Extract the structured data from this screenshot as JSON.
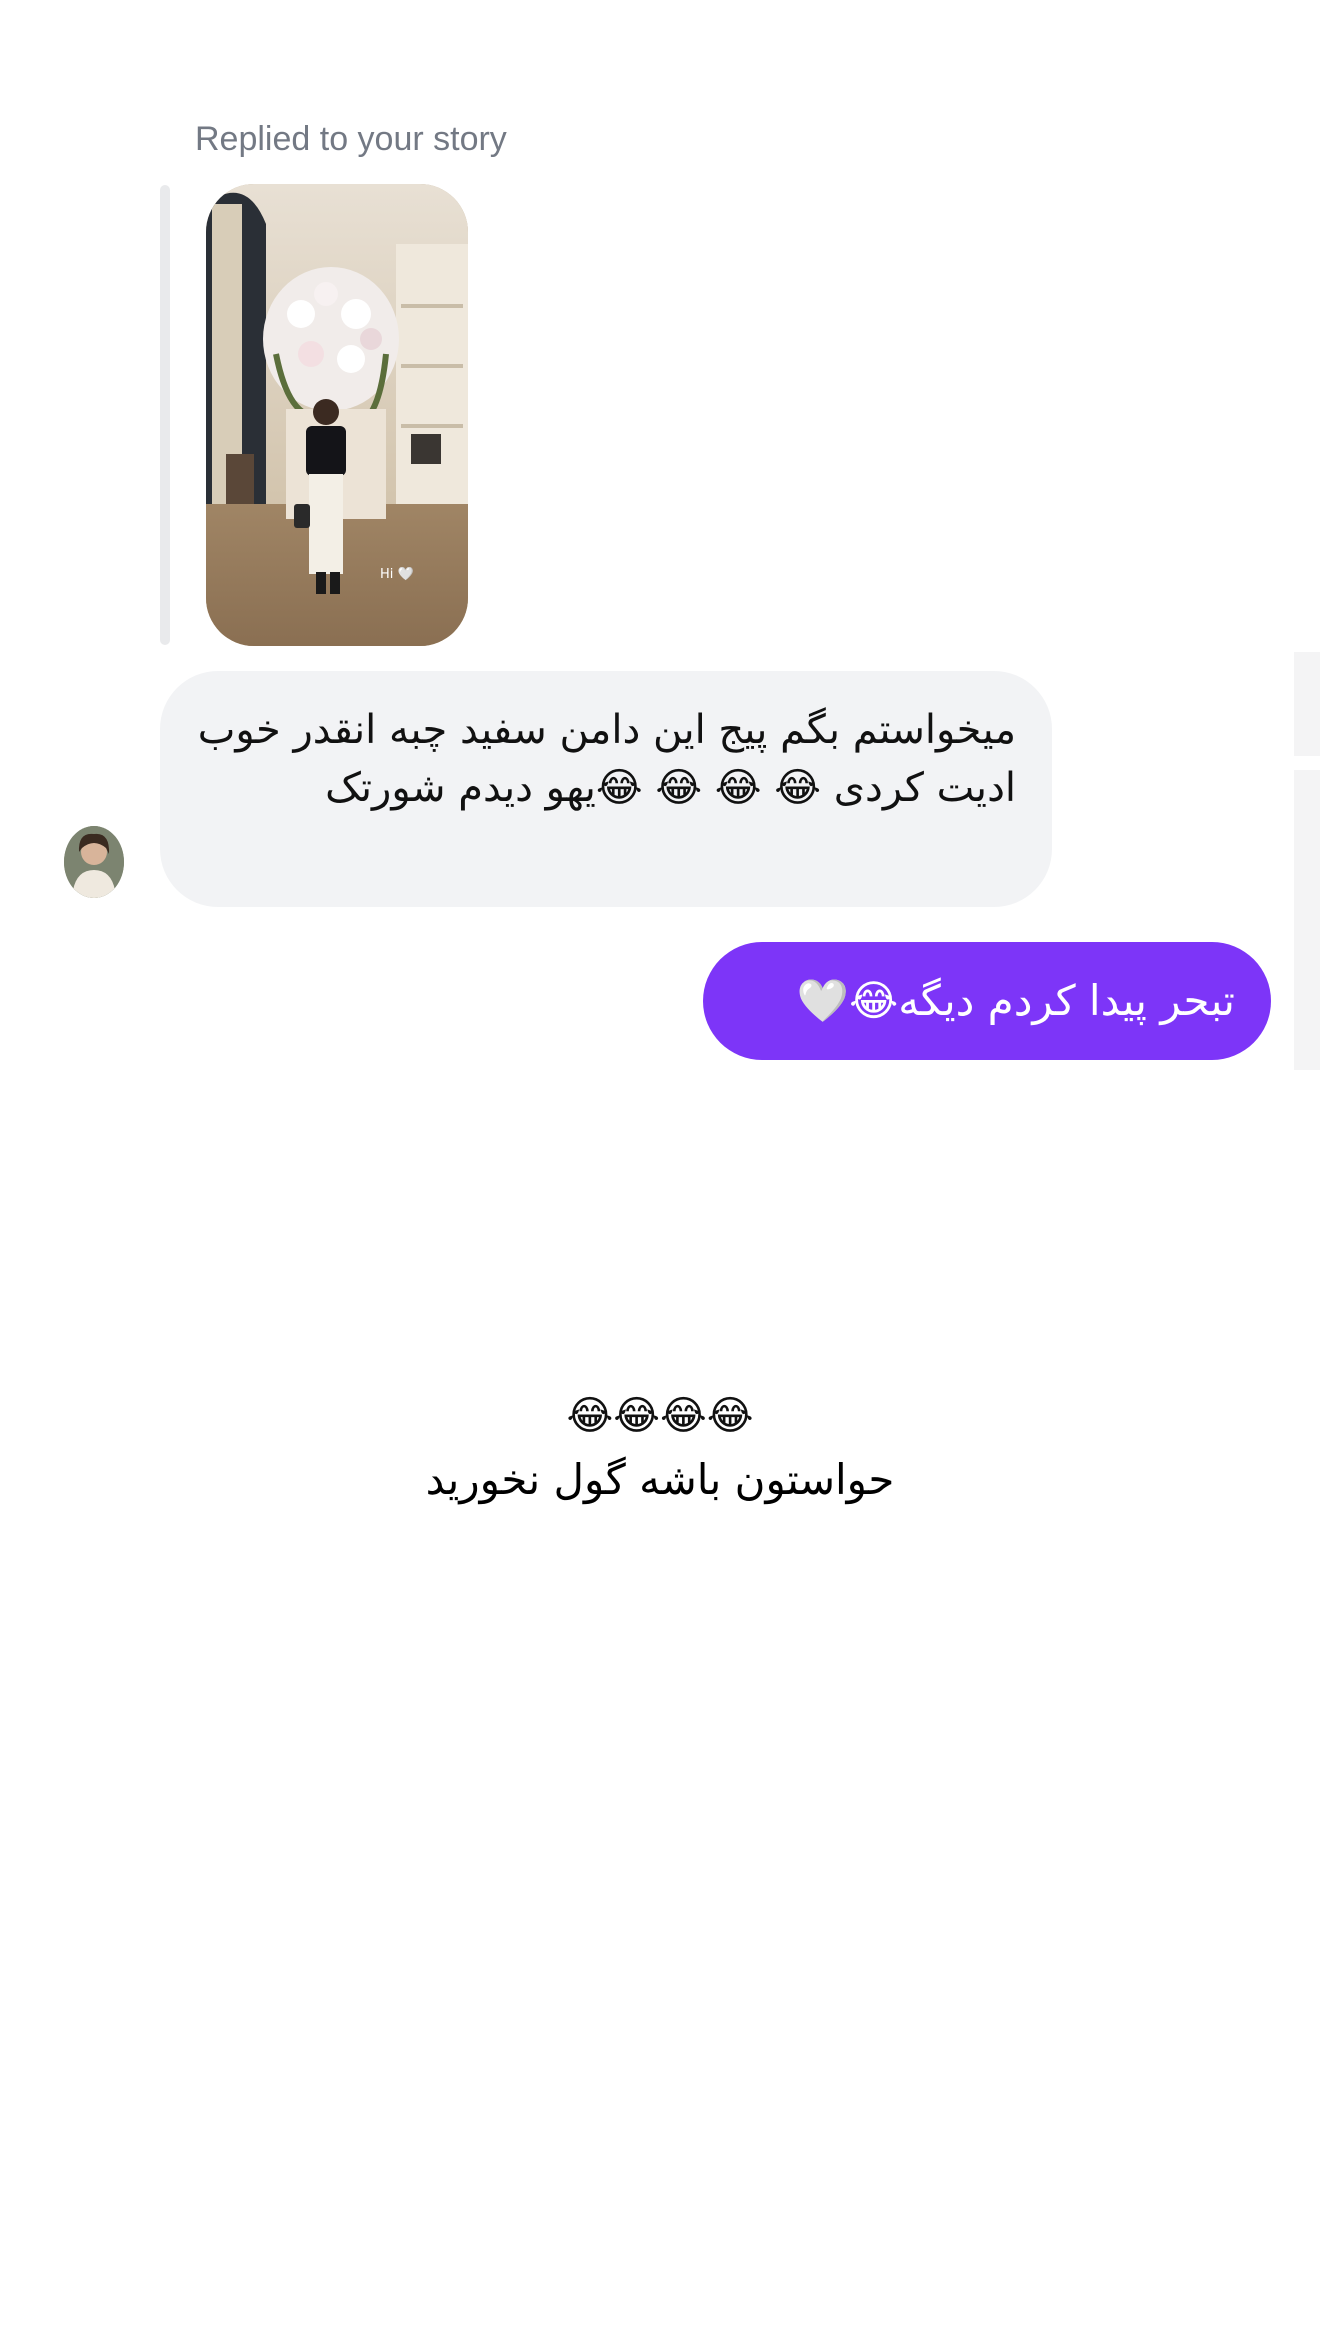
{
  "story_reply": {
    "label": "Replied to your story",
    "thumbnail_caption": "Hi 🤍"
  },
  "messages": {
    "incoming": {
      "text": "میخواستم بگم پیج این دامن سفید چبه انقدر خوب ادیت کردی 😂 😂 😂 😂یهو دیدم شورتک"
    },
    "outgoing": {
      "text": "تبحر پیدا کردم دیگه😂🤍"
    }
  },
  "overlay_caption": {
    "emoji_line": "😂😂😂😂",
    "text_line": "حواستون باشه گول نخورید"
  },
  "colors": {
    "outgoing_bubble": "#7d35f8",
    "incoming_bubble": "#f2f3f5",
    "label_gray": "#737984"
  },
  "icons": {
    "avatar": "user-avatar",
    "story": "story-thumbnail"
  }
}
